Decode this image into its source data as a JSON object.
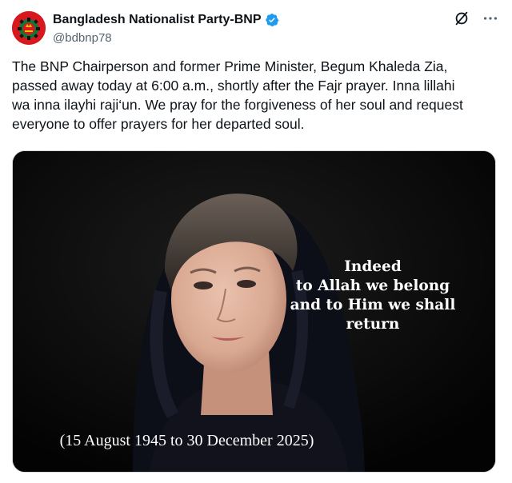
{
  "account": {
    "display_name": "Bangladesh Nationalist Party-BNP",
    "handle": "@bdbnp78",
    "verified": true,
    "verified_color": "#1d9bf0",
    "avatar_icon": "bnp-logo-icon"
  },
  "actions": {
    "grok_icon": "grok-icon",
    "more_icon": "more-options-icon"
  },
  "post": {
    "text": "The BNP Chairperson and former Prime Minister, Begum Khaleda Zia,\npassed away today at 6:00 a.m., shortly after the Fajr prayer. Inna lillahi\nwa inna ilayhi raji‘un. We pray for the forgiveness of her soul and request\neveryone to offer prayers for her departed soul."
  },
  "media": {
    "quote_lines": [
      "Indeed",
      "to Allah we belong",
      "and to Him we shall",
      "return"
    ],
    "dates": "(15 August 1945 to 30 December 2025)",
    "background_color": "#060606"
  }
}
